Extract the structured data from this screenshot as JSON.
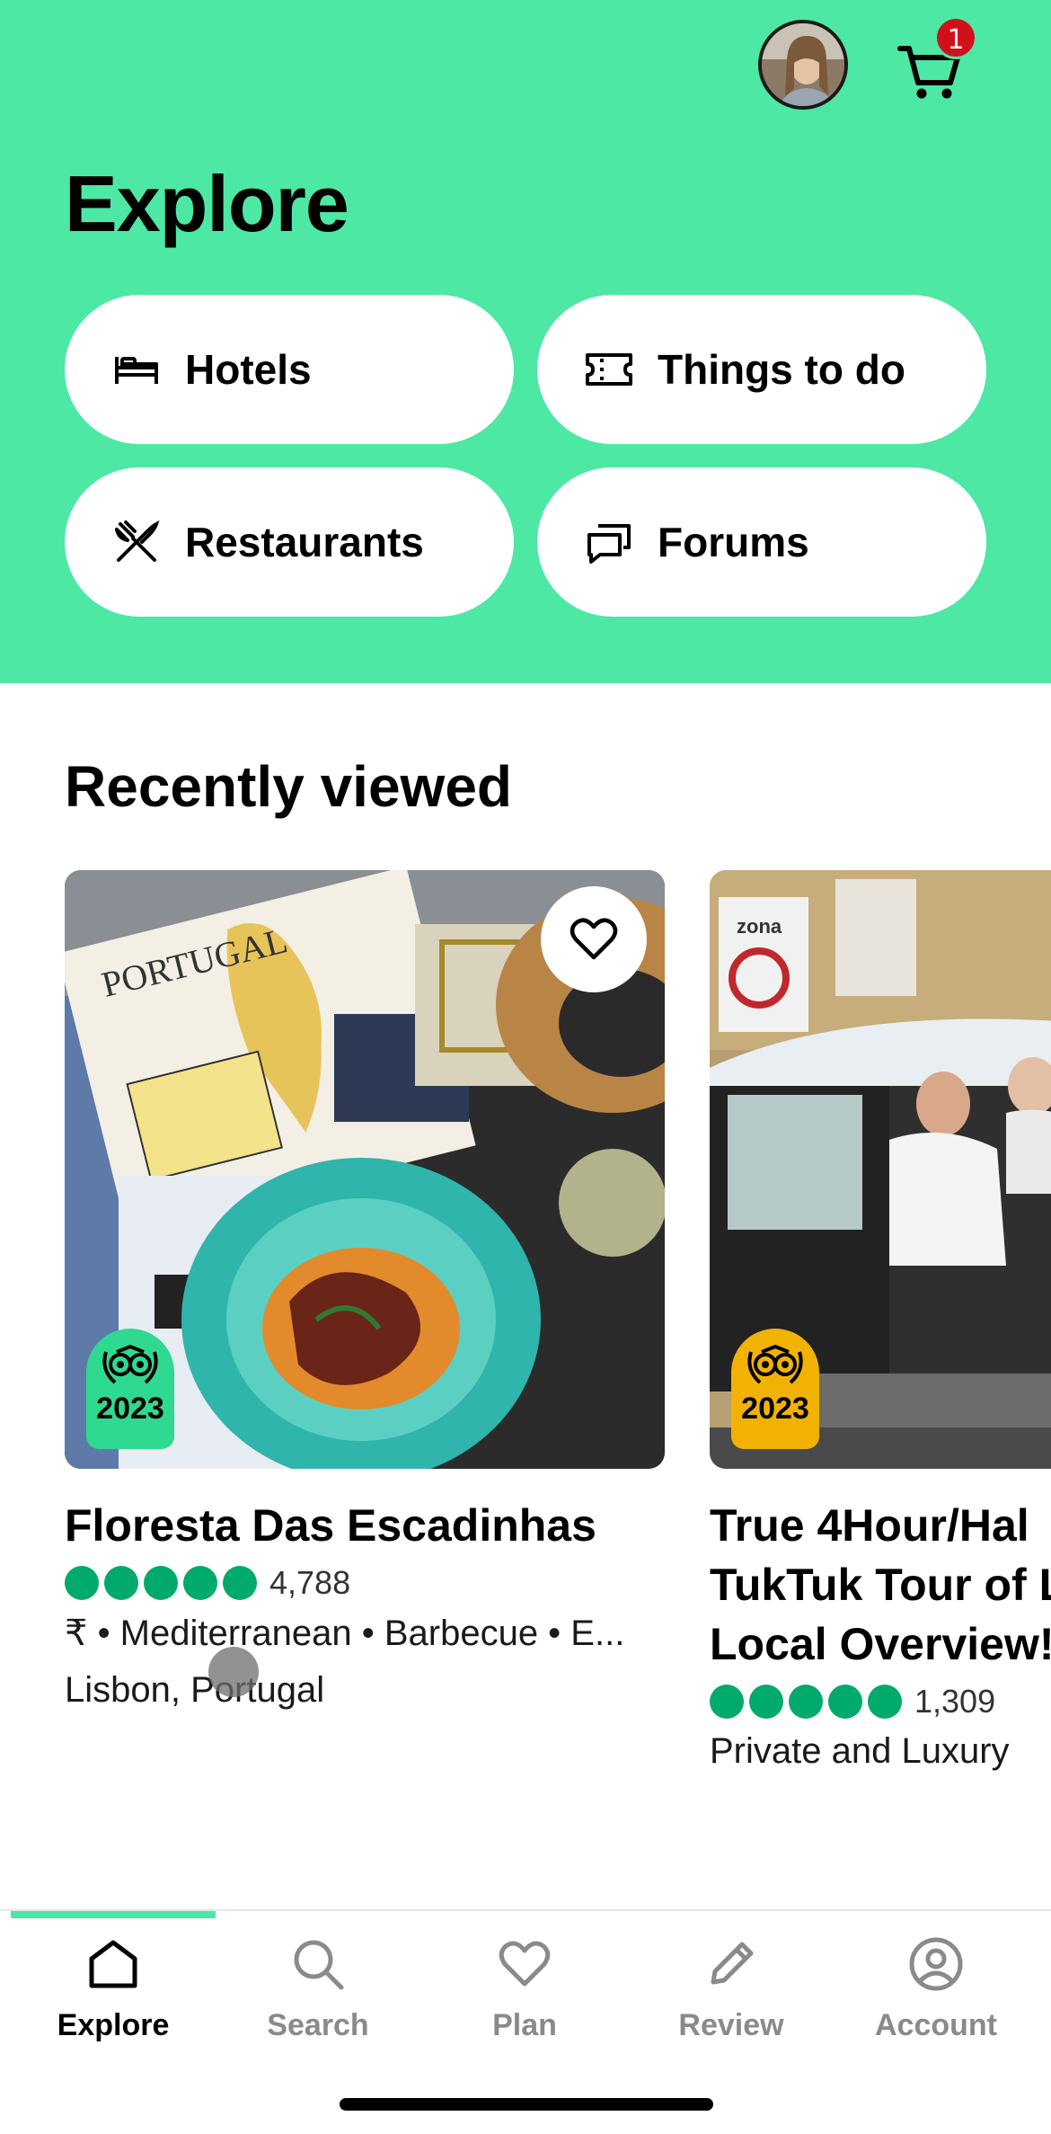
{
  "header": {
    "cart_badge": "1",
    "title": "Explore",
    "avatar_icon": "user-avatar",
    "cart_icon": "cart-icon"
  },
  "categories": [
    {
      "label": "Hotels",
      "icon": "bed-icon"
    },
    {
      "label": "Things to do",
      "icon": "ticket-icon"
    },
    {
      "label": "Restaurants",
      "icon": "fork-knife-icon"
    },
    {
      "label": "Forums",
      "icon": "chat-icon"
    }
  ],
  "recently_viewed": {
    "title": "Recently viewed",
    "cards": [
      {
        "title": "Floresta Das Escadinhas",
        "rating_bubbles": 5,
        "review_count": "4,788",
        "details": "₹ • Mediterranean • Barbecue • E...",
        "location": "Lisbon, Portugal",
        "award_year": "2023",
        "award_color": "#2fd98f"
      },
      {
        "title_lines": [
          "True 4Hour/Hal",
          "TukTuk Tour of L",
          "Local Overview!"
        ],
        "rating_bubbles": 5,
        "review_count": "1,309",
        "details": "Private and Luxury",
        "award_year": "2023",
        "award_color": "#f2b203"
      }
    ]
  },
  "bottom_nav": [
    {
      "label": "Explore",
      "icon": "home-icon",
      "active": true
    },
    {
      "label": "Search",
      "icon": "search-icon",
      "active": false
    },
    {
      "label": "Plan",
      "icon": "heart-icon",
      "active": false
    },
    {
      "label": "Review",
      "icon": "pencil-icon",
      "active": false
    },
    {
      "label": "Account",
      "icon": "account-icon",
      "active": false
    }
  ],
  "colors": {
    "brand_green": "#4de8a4",
    "rating_green": "#00aa6c",
    "badge_red": "#d2101b"
  }
}
